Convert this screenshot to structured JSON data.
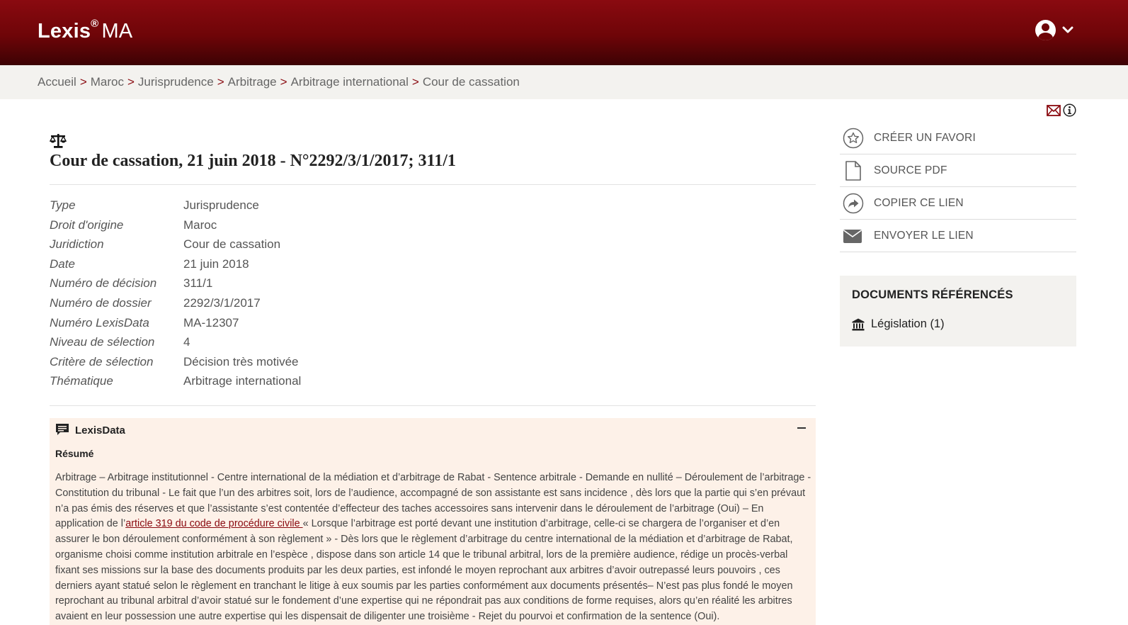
{
  "header": {
    "brand": "Lexis",
    "brand_mark": "®",
    "brand_suffix": "MA",
    "user_icon": "user-circle-icon",
    "menu_icon": "chevron-down-icon"
  },
  "breadcrumb": {
    "items": [
      "Accueil",
      "Maroc",
      "Jurisprudence",
      "Arbitrage",
      "Arbitrage international",
      "Cour de cassation"
    ],
    "separator": ">"
  },
  "document": {
    "icon": "scales-icon",
    "title": "Cour de cassation, 21 juin 2018 - N°2292/3/1/2017; 311/1",
    "metadata": [
      {
        "label": "Type",
        "value": "Jurisprudence"
      },
      {
        "label": "Droit d'origine",
        "value": "Maroc"
      },
      {
        "label": "Juridiction",
        "value": "Cour de cassation"
      },
      {
        "label": "Date",
        "value": "21 juin 2018"
      },
      {
        "label": "Numéro de décision",
        "value": "311/1"
      },
      {
        "label": "Numéro de dossier",
        "value": "2292/3/1/2017"
      },
      {
        "label": "Numéro LexisData",
        "value": "MA-12307"
      },
      {
        "label": "Niveau de sélection",
        "value": "4"
      },
      {
        "label": "Critère de sélection",
        "value": "Décision très motivée"
      },
      {
        "label": "Thématique",
        "value": "Arbitrage international"
      }
    ]
  },
  "lexisdata": {
    "title": "LexisData",
    "subtitle": "Résumé",
    "collapse_icon": "minus-icon",
    "text_before": "Arbitrage – Arbitrage institutionnel - Centre international de la médiation et d’arbitrage de Rabat - Sentence arbitrale - Demande en nullité – Déroulement de l’arbitrage - Constitution du tribunal - Le fait que l’un des arbitres soit, lors de l’audience, accompagné de son assistante est sans incidence , dès lors que la partie qui s’en prévaut n’a pas émis des réserves et que l’assistante s’est contentée d’effecteur des taches accessoires sans intervenir dans le déroulement de l’arbitrage (Oui) – En application de l’",
    "link_text": "article 319 du code de procédure civile ",
    "text_after": "« Lorsque l’arbitrage est porté devant une institution d’arbitrage, celle-ci se chargera de l’organiser et d’en assurer le bon déroulement conformément à son règlement » - Dès lors que le règlement d’arbitrage du centre international de la médiation et d’arbitrage de Rabat, organisme choisi comme institution arbitrale en l’espèce , dispose dans son article 14 que le tribunal arbitral, lors de la première audience, rédige un procès-verbal fixant ses missions sur la base des documents produits par les deux parties, est infondé le moyen reprochant aux arbitres d’avoir outrepassé leurs pouvoirs , ces derniers ayant statué selon le règlement en tranchant le litige à eux soumis par les parties conformément aux documents présentés– N’est pas plus fondé le moyen reprochant au tribunal arbitral d’avoir statué sur le fondement d’une expertise qui ne répondrait pas aux conditions de forme requises, alors qu’en réalité les arbitres avaient en leur possession une autre expertise qui les dispensait de diligenter une troisième - Rejet du pourvoi et confirmation de la sentence (Oui)."
  },
  "top_icons": [
    "mail-icon",
    "info-icon"
  ],
  "actions": [
    {
      "label": "CRÉER UN FAVORI",
      "icon": "star-icon"
    },
    {
      "label": "SOURCE PDF",
      "icon": "file-icon"
    },
    {
      "label": "COPIER CE LIEN",
      "icon": "share-icon"
    },
    {
      "label": "ENVOYER LE LIEN",
      "icon": "envelope-icon"
    }
  ],
  "references": {
    "title": "DOCUMENTS RÉFÉRENCÉS",
    "items": [
      {
        "label": "Législation (1)",
        "icon": "institution-icon"
      }
    ]
  },
  "colors": {
    "brand": "#8a0a10",
    "header_dark": "#3c0204",
    "summary_bg": "#fdf1e8",
    "panel_bg": "#f3f2ef"
  }
}
